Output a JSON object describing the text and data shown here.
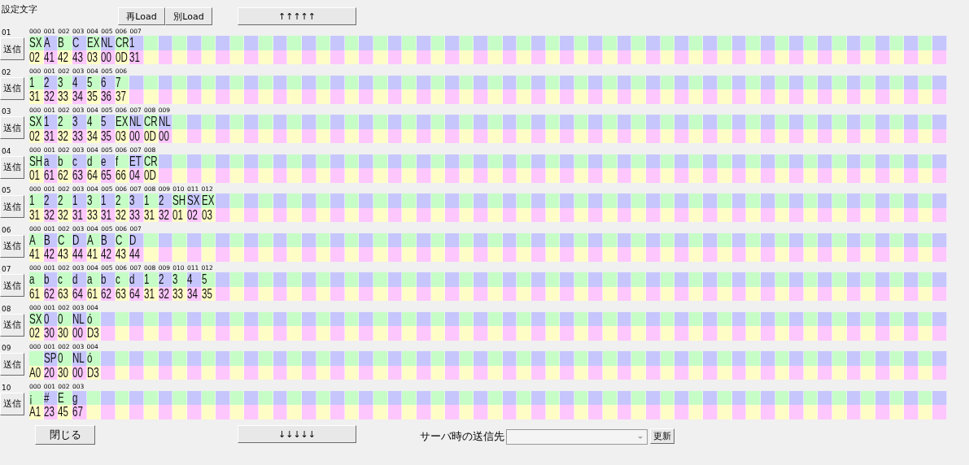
{
  "title": "設定文字",
  "top_buttons": [
    "再Load",
    "別Load"
  ],
  "up_button": "↑↑↑↑↑",
  "rows": [
    {
      "number": "01",
      "send": "送信",
      "cells": [
        {
          "index": "000",
          "char": "SX",
          "hex": "02"
        },
        {
          "index": "001",
          "char": "A",
          "hex": "41"
        },
        {
          "index": "002",
          "char": "B",
          "hex": "42"
        },
        {
          "index": "003",
          "char": "C",
          "hex": "43"
        },
        {
          "index": "004",
          "char": "EX",
          "hex": "03"
        },
        {
          "index": "005",
          "char": "NL",
          "hex": "00"
        },
        {
          "index": "006",
          "char": "CR",
          "hex": "0D"
        },
        {
          "index": "007",
          "char": "1",
          "hex": "31"
        }
      ]
    },
    {
      "number": "02",
      "send": "送信",
      "cells": [
        {
          "index": "000",
          "char": "1",
          "hex": "31"
        },
        {
          "index": "001",
          "char": "2",
          "hex": "32"
        },
        {
          "index": "002",
          "char": "3",
          "hex": "33"
        },
        {
          "index": "003",
          "char": "4",
          "hex": "34"
        },
        {
          "index": "004",
          "char": "5",
          "hex": "35"
        },
        {
          "index": "005",
          "char": "6",
          "hex": "36"
        },
        {
          "index": "006",
          "char": "7",
          "hex": "37"
        }
      ]
    },
    {
      "number": "03",
      "send": "送信",
      "cells": [
        {
          "index": "000",
          "char": "SX",
          "hex": "02"
        },
        {
          "index": "001",
          "char": "1",
          "hex": "31"
        },
        {
          "index": "002",
          "char": "2",
          "hex": "32"
        },
        {
          "index": "003",
          "char": "3",
          "hex": "33"
        },
        {
          "index": "004",
          "char": "4",
          "hex": "34"
        },
        {
          "index": "005",
          "char": "5",
          "hex": "35"
        },
        {
          "index": "006",
          "char": "EX",
          "hex": "03"
        },
        {
          "index": "007",
          "char": "NL",
          "hex": "00"
        },
        {
          "index": "008",
          "char": "CR",
          "hex": "0D"
        },
        {
          "index": "009",
          "char": "NL",
          "hex": "00"
        }
      ]
    },
    {
      "number": "04",
      "send": "送信",
      "cells": [
        {
          "index": "000",
          "char": "SH",
          "hex": "01"
        },
        {
          "index": "001",
          "char": "a",
          "hex": "61"
        },
        {
          "index": "002",
          "char": "b",
          "hex": "62"
        },
        {
          "index": "003",
          "char": "c",
          "hex": "63"
        },
        {
          "index": "004",
          "char": "d",
          "hex": "64"
        },
        {
          "index": "005",
          "char": "e",
          "hex": "65"
        },
        {
          "index": "006",
          "char": "f",
          "hex": "66"
        },
        {
          "index": "007",
          "char": "ET",
          "hex": "04"
        },
        {
          "index": "008",
          "char": "CR",
          "hex": "0D"
        }
      ]
    },
    {
      "number": "05",
      "send": "送信",
      "cells": [
        {
          "index": "000",
          "char": "1",
          "hex": "31"
        },
        {
          "index": "001",
          "char": "2",
          "hex": "32"
        },
        {
          "index": "002",
          "char": "2",
          "hex": "32"
        },
        {
          "index": "003",
          "char": "1",
          "hex": "31"
        },
        {
          "index": "004",
          "char": "3",
          "hex": "33"
        },
        {
          "index": "005",
          "char": "1",
          "hex": "31"
        },
        {
          "index": "006",
          "char": "2",
          "hex": "32"
        },
        {
          "index": "007",
          "char": "3",
          "hex": "33"
        },
        {
          "index": "008",
          "char": "1",
          "hex": "31"
        },
        {
          "index": "009",
          "char": "2",
          "hex": "32"
        },
        {
          "index": "010",
          "char": "SH",
          "hex": "01"
        },
        {
          "index": "011",
          "char": "SX",
          "hex": "02"
        },
        {
          "index": "012",
          "char": "EX",
          "hex": "03"
        }
      ]
    },
    {
      "number": "06",
      "send": "送信",
      "cells": [
        {
          "index": "000",
          "char": "A",
          "hex": "41"
        },
        {
          "index": "001",
          "char": "B",
          "hex": "42"
        },
        {
          "index": "002",
          "char": "C",
          "hex": "43"
        },
        {
          "index": "003",
          "char": "D",
          "hex": "44"
        },
        {
          "index": "004",
          "char": "A",
          "hex": "41"
        },
        {
          "index": "005",
          "char": "B",
          "hex": "42"
        },
        {
          "index": "006",
          "char": "C",
          "hex": "43"
        },
        {
          "index": "007",
          "char": "D",
          "hex": "44"
        }
      ]
    },
    {
      "number": "07",
      "send": "送信",
      "cells": [
        {
          "index": "000",
          "char": "a",
          "hex": "61"
        },
        {
          "index": "001",
          "char": "b",
          "hex": "62"
        },
        {
          "index": "002",
          "char": "c",
          "hex": "63"
        },
        {
          "index": "003",
          "char": "d",
          "hex": "64"
        },
        {
          "index": "004",
          "char": "a",
          "hex": "61"
        },
        {
          "index": "005",
          "char": "b",
          "hex": "62"
        },
        {
          "index": "006",
          "char": "c",
          "hex": "63"
        },
        {
          "index": "007",
          "char": "d",
          "hex": "64"
        },
        {
          "index": "008",
          "char": "1",
          "hex": "31"
        },
        {
          "index": "009",
          "char": "2",
          "hex": "32"
        },
        {
          "index": "010",
          "char": "3",
          "hex": "33"
        },
        {
          "index": "011",
          "char": "4",
          "hex": "34"
        },
        {
          "index": "012",
          "char": "5",
          "hex": "35"
        }
      ]
    },
    {
      "number": "08",
      "send": "送信",
      "cells": [
        {
          "index": "000",
          "char": "SX",
          "hex": "02"
        },
        {
          "index": "001",
          "char": "0",
          "hex": "30"
        },
        {
          "index": "002",
          "char": "0",
          "hex": "30"
        },
        {
          "index": "003",
          "char": "NL",
          "hex": "00"
        },
        {
          "index": "004",
          "char": "ó",
          "hex": "D3"
        }
      ]
    },
    {
      "number": "09",
      "send": "送信",
      "cells": [
        {
          "index": "000",
          "hex": "A0"
        },
        {
          "index": "001",
          "char": "SP",
          "hex": "20"
        },
        {
          "index": "002",
          "char": "0",
          "hex": "30"
        },
        {
          "index": "003",
          "char": "NL",
          "hex": "00"
        },
        {
          "index": "004",
          "char": "ó",
          "hex": "D3"
        }
      ]
    },
    {
      "number": "10",
      "send": "送信",
      "cells": [
        {
          "index": "000",
          "char": "¡",
          "hex": "A1"
        },
        {
          "index": "001",
          "char": "#",
          "hex": "23"
        },
        {
          "index": "002",
          "char": "E",
          "hex": "45"
        },
        {
          "index": "003",
          "char": "g",
          "hex": "67"
        }
      ]
    }
  ],
  "close_button": "閉じる",
  "down_button": "↓↓↓↓↓",
  "destination": {
    "label": "サーバ時の送信先"
  },
  "update_button": "更新"
}
